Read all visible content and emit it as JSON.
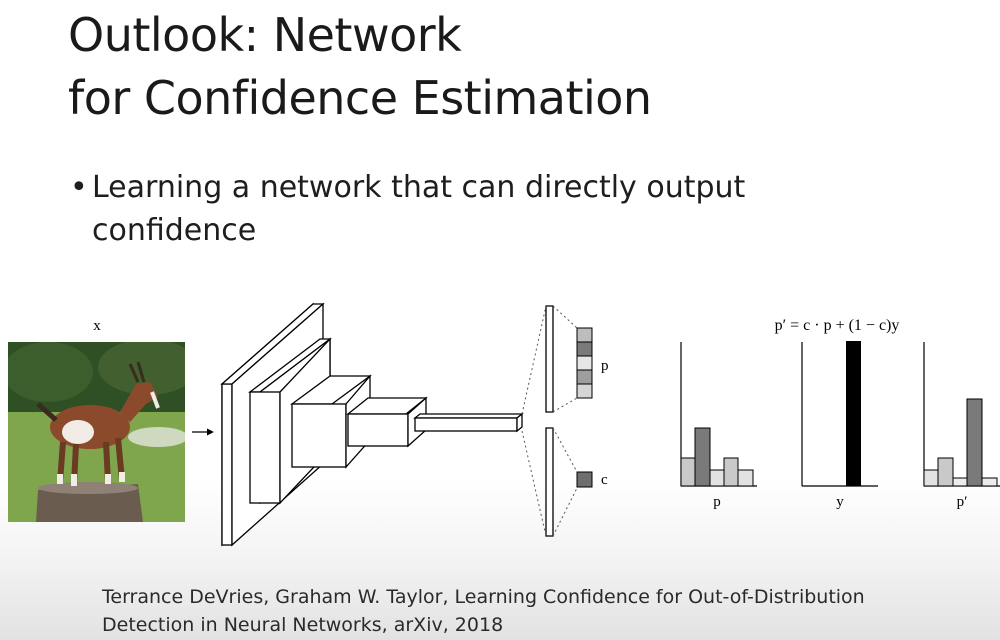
{
  "slide": {
    "title_line1": "Outlook: Network",
    "title_line2": "for Confidence Estimation",
    "bullet": "Learning a network that can directly output confidence",
    "citation_line1": "Terrance DeVries, Graham W. Taylor, Learning Confidence for Out-of-Distribution",
    "citation_line2": "Detection in Neural Networks, arXiv, 2018"
  },
  "figure": {
    "input_label": "x",
    "p_label": "p",
    "c_label": "c",
    "equation": "p′ = c · p + (1 − c)y",
    "chart_labels": [
      "p",
      "y",
      "p′"
    ],
    "colors": {
      "light_bar": "#c9c9c9",
      "dark_bar": "#7a7a7a",
      "black_bar": "#000000"
    }
  }
}
